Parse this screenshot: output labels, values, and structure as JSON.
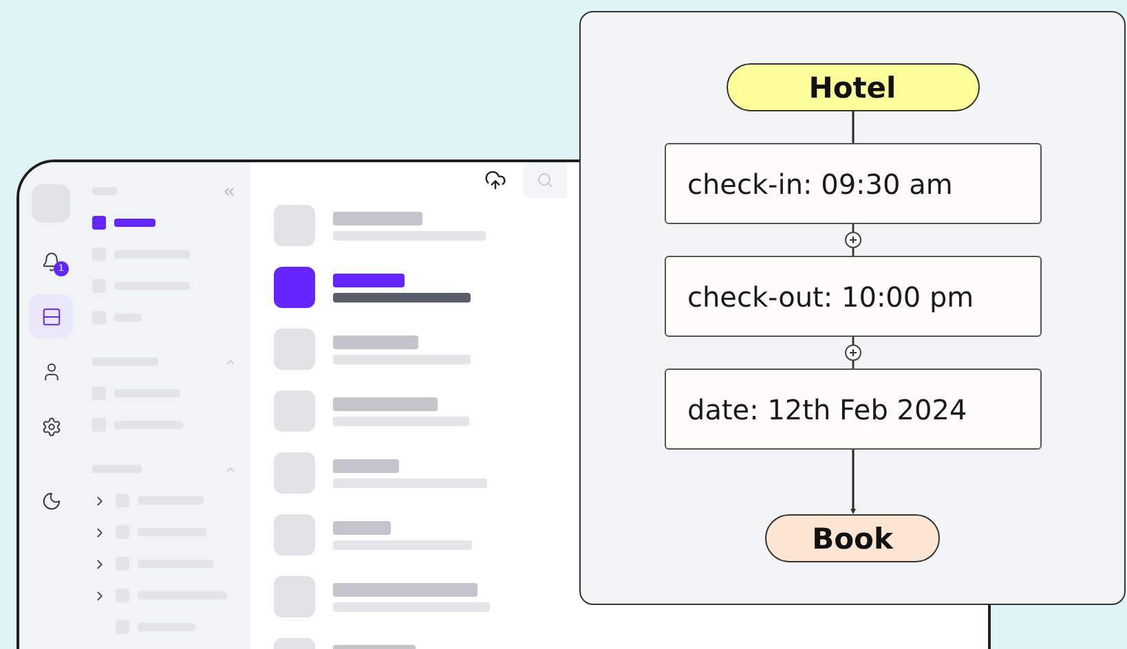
{
  "app": {
    "nav": [
      {
        "kind": "bell",
        "selected": false,
        "badge": "1"
      },
      {
        "kind": "layout",
        "selected": true
      },
      {
        "kind": "user",
        "selected": false
      },
      {
        "kind": "settings",
        "selected": false
      },
      {
        "kind": "moon",
        "selected": false
      }
    ],
    "sidebar": {
      "groups": [
        {
          "kind": "sidebar",
          "items": [
            {
              "selected": true,
              "expandable": false
            },
            {
              "selected": false,
              "expandable": false
            },
            {
              "selected": false,
              "expandable": false
            },
            {
              "selected": false,
              "expandable": false
            }
          ]
        },
        {
          "kind": "group",
          "items": [
            {
              "selected": false,
              "expandable": false
            },
            {
              "selected": false,
              "expandable": false
            }
          ]
        },
        {
          "kind": "group",
          "items": [
            {
              "selected": false,
              "expandable": true
            },
            {
              "selected": false,
              "expandable": true
            },
            {
              "selected": false,
              "expandable": true
            },
            {
              "selected": false,
              "expandable": true
            },
            {
              "selected": false,
              "expandable": false
            }
          ]
        }
      ]
    },
    "list": [
      {
        "selected": false
      },
      {
        "selected": true
      },
      {
        "selected": false
      },
      {
        "selected": false
      },
      {
        "selected": false
      },
      {
        "selected": false
      },
      {
        "selected": false
      },
      {
        "selected": false
      }
    ]
  },
  "flow": {
    "start": "Hotel",
    "steps": [
      "check-in: 09:30 am",
      "check-out: 10:00 pm",
      "date: 12th Feb 2024"
    ],
    "end": "Book"
  }
}
